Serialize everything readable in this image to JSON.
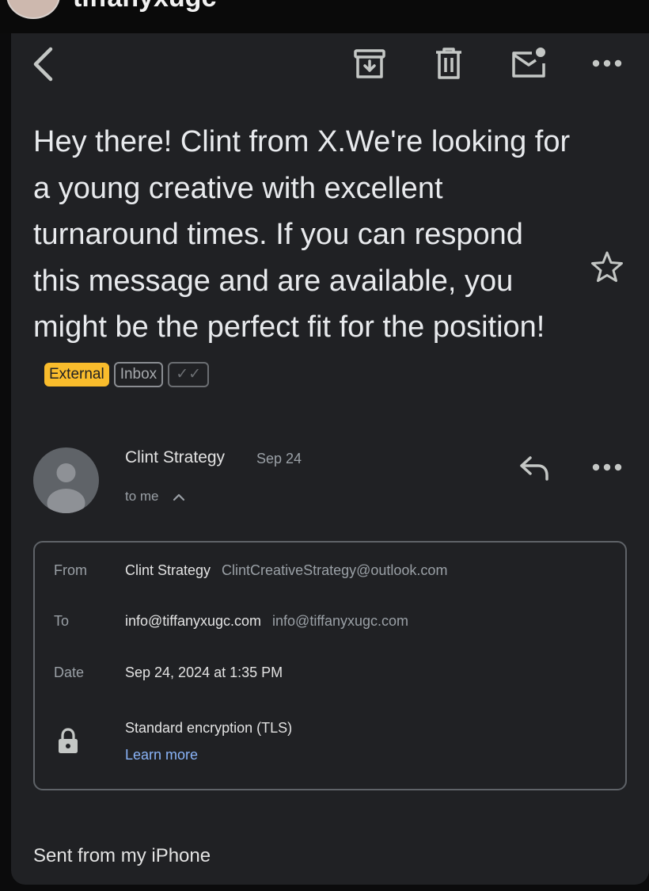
{
  "top": {
    "username": "tiffanyxugc"
  },
  "email": {
    "subject": "Hey there! Clint from X.We're looking for a young creative with excellent turnaround times. If you can respond this message and are available, you might be the perfect fit for the position!",
    "labels": {
      "external": "External",
      "inbox": "Inbox",
      "checks": "✓✓"
    },
    "sender": {
      "name": "Clint Strategy",
      "date": "Sep 24",
      "recipient_summary": "to me"
    },
    "details": {
      "from_label": "From",
      "from_name": "Clint Strategy",
      "from_email": "ClintCreativeStrategy@outlook.com",
      "to_label": "To",
      "to_name": "info@tiffanyxugc.com",
      "to_email": "info@tiffanyxugc.com",
      "date_label": "Date",
      "date_value": "Sep 24, 2024 at 1:35 PM",
      "encryption": "Standard encryption (TLS)",
      "learn_more": "Learn more"
    },
    "body": "Sent from my iPhone"
  },
  "icons": [
    "back-icon",
    "archive-icon",
    "delete-icon",
    "mark-unread-icon",
    "more-icon",
    "star-icon",
    "reply-icon",
    "lock-icon"
  ],
  "colors": {
    "background": "#202124",
    "external_badge": "#f9bc2c",
    "link": "#8ab4f8"
  }
}
